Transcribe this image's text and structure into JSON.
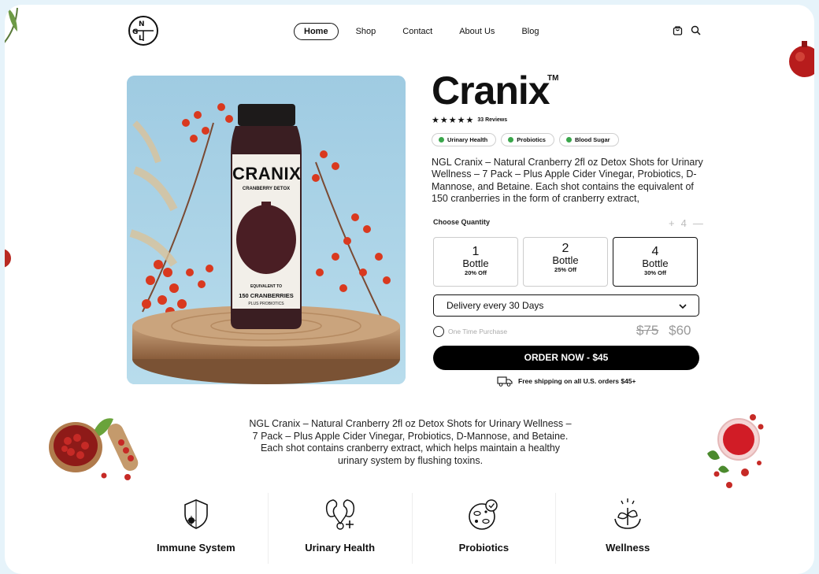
{
  "nav": {
    "logo_letters": [
      "N",
      "G",
      "L"
    ],
    "items": [
      {
        "label": "Home",
        "active": true
      },
      {
        "label": "Shop"
      },
      {
        "label": "Contact"
      },
      {
        "label": "About Us"
      },
      {
        "label": "Blog"
      }
    ],
    "icons": [
      "cart-icon",
      "search-icon"
    ]
  },
  "product": {
    "bottle_brand": "CRANIX",
    "bottle_subtitle": "CRANBERRY DETOX",
    "bottle_equiv": "EQUIVALENT TO",
    "bottle_count": "150 CRANBERRIES",
    "bottle_plus": "PLUS PROBIOTICS",
    "title": "Cranix",
    "tm": "TM",
    "rating": 5,
    "reviews": "33 Reviews",
    "tags": [
      "Urinary Health",
      "Probiotics",
      "Blood Sugar"
    ],
    "description": "NGL  Cranix – Natural Cranberry 2fl oz Detox Shots for Urinary Wellness – 7  Pack – Plus Apple Cider Vinegar, Probiotics, D-Mannose, and Betaine. Each shot contains the equivalent of 150 cranberries in the form of cranberry extract,",
    "choose_quantity": "Choose Quantity",
    "stepper": {
      "plus": "+",
      "value": "4",
      "minus": "—"
    },
    "options": [
      {
        "n": "1",
        "unit": "Bottle",
        "discount": "20% Off",
        "selected": false
      },
      {
        "n": "2",
        "unit": "Bottle",
        "discount": "25% Off",
        "selected": false
      },
      {
        "n": "4",
        "unit": "Bottle",
        "discount": "30% Off",
        "selected": true
      }
    ],
    "delivery": "Delivery every 30 Days",
    "one_time": "One Time Purchase",
    "old_price": "$75",
    "price": "$60",
    "order_button": "ORDER NOW - $45",
    "shipping": "Free shipping on all U.S. orders $45+"
  },
  "lower": {
    "description": "NGL  Cranix – Natural Cranberry 2fl oz Detox Shots for Urinary Wellness – 7  Pack – Plus Apple Cider Vinegar, Probiotics, D-Mannose, and Betaine. Each shot contains cranberry extract, which helps maintain a  healthy urinary system by flushing toxins.",
    "features": [
      {
        "label": "Immune System",
        "icon": "shield-virus-icon"
      },
      {
        "label": "Urinary Health",
        "icon": "kidneys-icon"
      },
      {
        "label": "Probiotics",
        "icon": "probiotic-cell-icon"
      },
      {
        "label": "Wellness",
        "icon": "plant-hands-icon"
      }
    ]
  },
  "colors": {
    "accent": "#000000",
    "tag_dot": "#3aa64b",
    "berry": "#c8261c",
    "sky": "#a9cfe3"
  }
}
